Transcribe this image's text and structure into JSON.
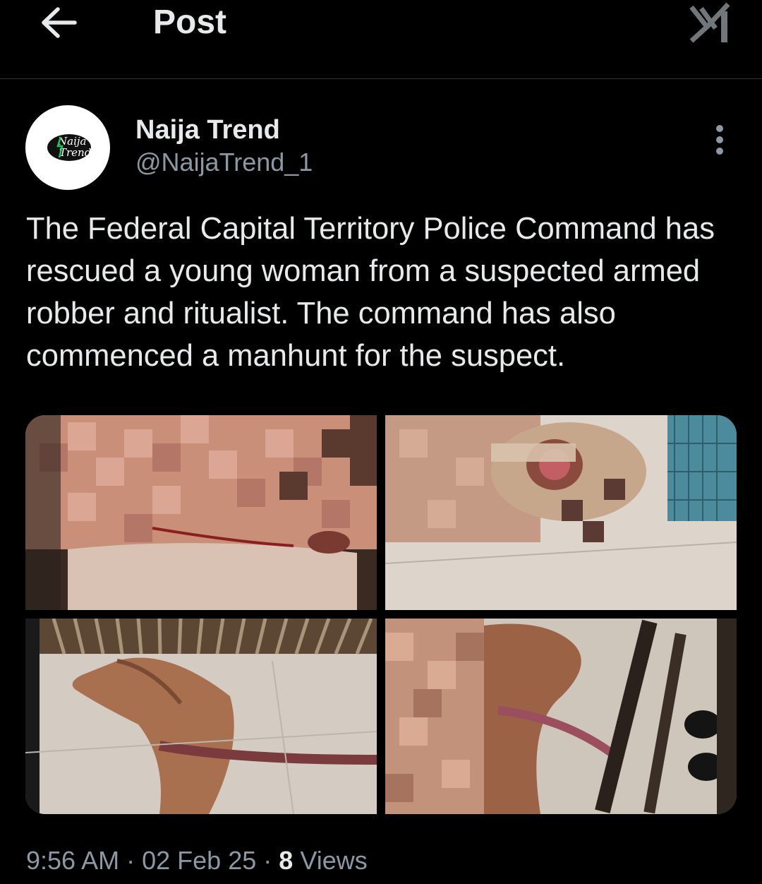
{
  "header": {
    "title": "Post",
    "back_icon": "arrow-left-icon",
    "logo_icon": "x-logo-icon"
  },
  "author": {
    "display_name": "Naija Trend",
    "handle": "@NaijaTrend_1",
    "avatar_logo_lines": [
      "Naija",
      "Trend"
    ],
    "more_icon": "more-vertical-icon"
  },
  "post": {
    "text": "The Federal Capital Territory Police Command has rescued a young woman from a suspected armed robber and ritualist. The command has also commenced a manhunt for the suspect.",
    "media_count": 4
  },
  "meta": {
    "time": "9:56 AM",
    "separator": "·",
    "date": "02 Feb 25",
    "views_count": "8",
    "views_label": "Views"
  },
  "colors": {
    "background": "#000000",
    "primary_text": "#e7e9ea",
    "secondary_text": "#8b98a5",
    "divider": "#2f3336"
  }
}
